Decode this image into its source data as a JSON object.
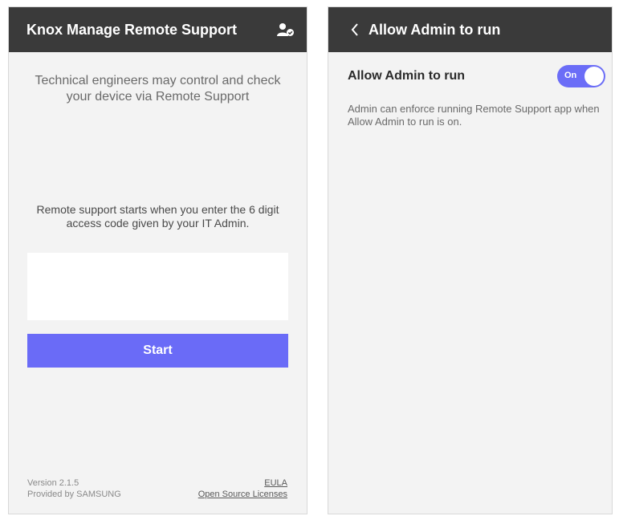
{
  "left_screen": {
    "app_bar": {
      "title": "Knox Manage Remote Support",
      "icon": "person-check-icon"
    },
    "intro_text": "Technical engineers may control and check your device via Remote Support",
    "code_instruction": "Remote support starts when you enter the 6 digit access code given by your IT Admin.",
    "code_input": {
      "value": "",
      "placeholder": ""
    },
    "start_button": "Start",
    "footer": {
      "version": "Version 2.1.5",
      "provider": "Provided by SAMSUNG",
      "eula": "EULA",
      "licenses": "Open Source Licenses"
    }
  },
  "right_screen": {
    "app_bar": {
      "title": "Allow Admin to run",
      "back_icon": "chevron-left-icon"
    },
    "setting": {
      "label": "Allow Admin to run",
      "toggle_label": "On",
      "toggle_state": true,
      "description": "Admin can enforce running Remote Support app when Allow Admin to run is on."
    }
  },
  "colors": {
    "app_bar": "#3a3a3a",
    "accent": "#6a6bf7",
    "background": "#f3f3f3"
  }
}
